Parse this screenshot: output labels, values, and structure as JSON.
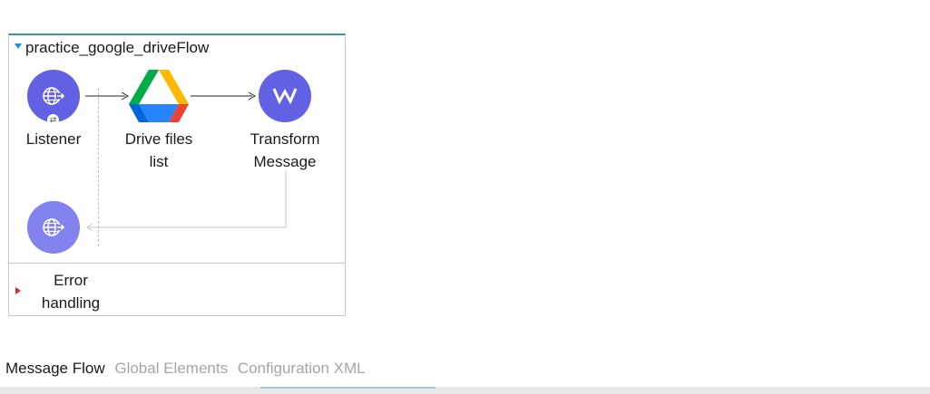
{
  "flow": {
    "title": "practice_google_driveFlow",
    "nodes": {
      "listener": {
        "label": "Listener",
        "icon": "http-globe-icon"
      },
      "drive": {
        "label_line1": "Drive files",
        "label_line2": "list",
        "icon": "google-drive-icon"
      },
      "transform": {
        "label_line1": "Transform",
        "label_line2": "Message",
        "icon": "dataweave-icon"
      },
      "response": {
        "icon": "http-globe-icon"
      }
    },
    "error_handling": {
      "line1": "Error",
      "line2": "handling"
    }
  },
  "tabs": [
    {
      "label": "Message Flow",
      "active": true
    },
    {
      "label": "Global Elements",
      "active": false
    },
    {
      "label": "Configuration XML",
      "active": false
    }
  ],
  "colors": {
    "node_primary": "#6261e3",
    "node_light": "#8382ee",
    "flow_border_accent": "#3c8dc4",
    "error_marker": "#c9302c"
  }
}
